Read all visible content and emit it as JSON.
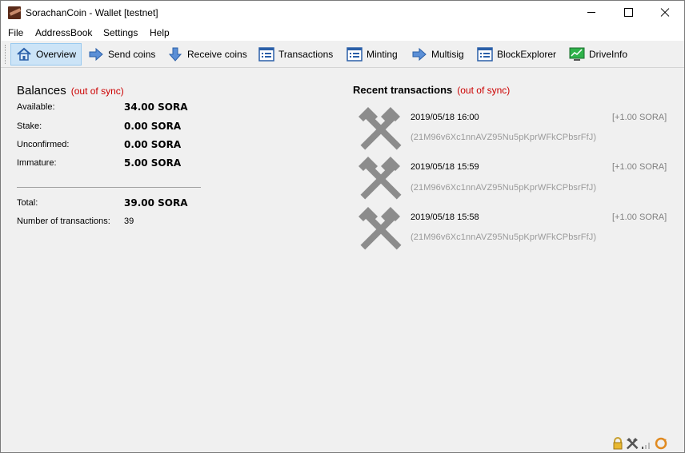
{
  "window": {
    "title": "SorachanCoin - Wallet [testnet]"
  },
  "menu": [
    "File",
    "AddressBook",
    "Settings",
    "Help"
  ],
  "toolbar": [
    {
      "label": "Overview",
      "icon": "home-icon",
      "active": true
    },
    {
      "label": "Send coins",
      "icon": "send-arrow-icon"
    },
    {
      "label": "Receive coins",
      "icon": "receive-arrow-icon"
    },
    {
      "label": "Transactions",
      "icon": "list-icon"
    },
    {
      "label": "Minting",
      "icon": "list-icon"
    },
    {
      "label": "Multisig",
      "icon": "send-arrow-icon"
    },
    {
      "label": "BlockExplorer",
      "icon": "list-icon"
    },
    {
      "label": "DriveInfo",
      "icon": "chart-monitor-icon"
    }
  ],
  "balances": {
    "title": "Balances",
    "sync_status": "(out of sync)",
    "rows": [
      {
        "label": "Available:",
        "value": "34.00 SORA"
      },
      {
        "label": "Stake:",
        "value": "0.00 SORA"
      },
      {
        "label": "Unconfirmed:",
        "value": "0.00 SORA"
      },
      {
        "label": "Immature:",
        "value": "5.00 SORA"
      }
    ],
    "total_label": "Total:",
    "total_value": "39.00 SORA",
    "num_tx_label": "Number of transactions:",
    "num_tx_value": "39"
  },
  "recent": {
    "title": "Recent transactions",
    "sync_status": "(out of sync)",
    "items": [
      {
        "date": "2019/05/18 16:00",
        "amount": "[+1.00 SORA]",
        "address": "(21M96v6Xc1nnAVZ95Nu5pKprWFkCPbsrFfJ)",
        "icon": "mining-pickaxe-icon"
      },
      {
        "date": "2019/05/18 15:59",
        "amount": "[+1.00 SORA]",
        "address": "(21M96v6Xc1nnAVZ95Nu5pKprWFkCPbsrFfJ)",
        "icon": "mining-pickaxe-icon"
      },
      {
        "date": "2019/05/18 15:58",
        "amount": "[+1.00 SORA]",
        "address": "(21M96v6Xc1nnAVZ95Nu5pKprWFkCPbsrFfJ)",
        "icon": "mining-pickaxe-icon"
      }
    ]
  },
  "status_bar": {
    "icons": [
      "lock-icon",
      "mining-icon",
      "signal-bars-icon",
      "sync-icon"
    ]
  }
}
